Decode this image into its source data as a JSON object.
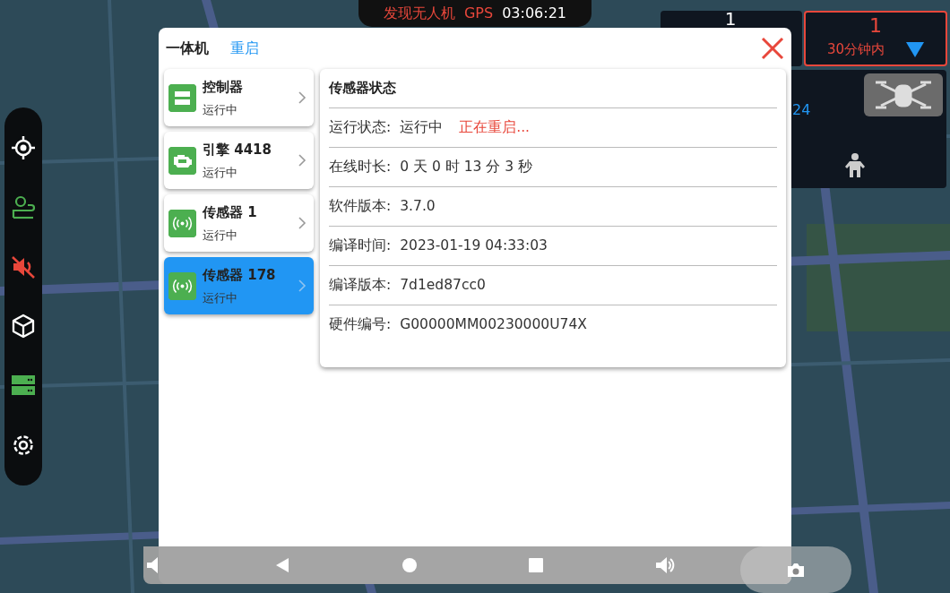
{
  "status_pill": {
    "alert": "发现无人机",
    "gps": "GPS",
    "time": "03:06:21"
  },
  "counter_panel": {
    "count": "1"
  },
  "alert_panel": {
    "count": "1",
    "range": "30分钟内"
  },
  "target_panel": {
    "value": "24"
  },
  "dialog": {
    "title": "一体机",
    "action": "重启",
    "devices": [
      {
        "kind": "controller",
        "name": "控制器",
        "status": "运行中",
        "selected": false
      },
      {
        "kind": "engine",
        "name": "引擎 4418",
        "status": "运行中",
        "selected": false
      },
      {
        "kind": "sensor",
        "name": "传感器 1",
        "status": "运行中",
        "selected": false
      },
      {
        "kind": "sensor",
        "name": "传感器 178",
        "status": "运行中",
        "selected": true
      }
    ],
    "detail": {
      "title": "传感器状态",
      "rows": [
        {
          "label": "运行状态:",
          "value": "运行中",
          "note": "正在重启..."
        },
        {
          "label": "在线时长:",
          "value": "0 天 0 时 13 分 3 秒"
        },
        {
          "label": "软件版本:",
          "value": "3.7.0"
        },
        {
          "label": "编译时间:",
          "value": "2023-01-19 04:33:03"
        },
        {
          "label": "编译版本:",
          "value": "7d1ed87cc0"
        },
        {
          "label": "硬件编号:",
          "value": "G00000MM00230000U74X"
        }
      ]
    }
  }
}
